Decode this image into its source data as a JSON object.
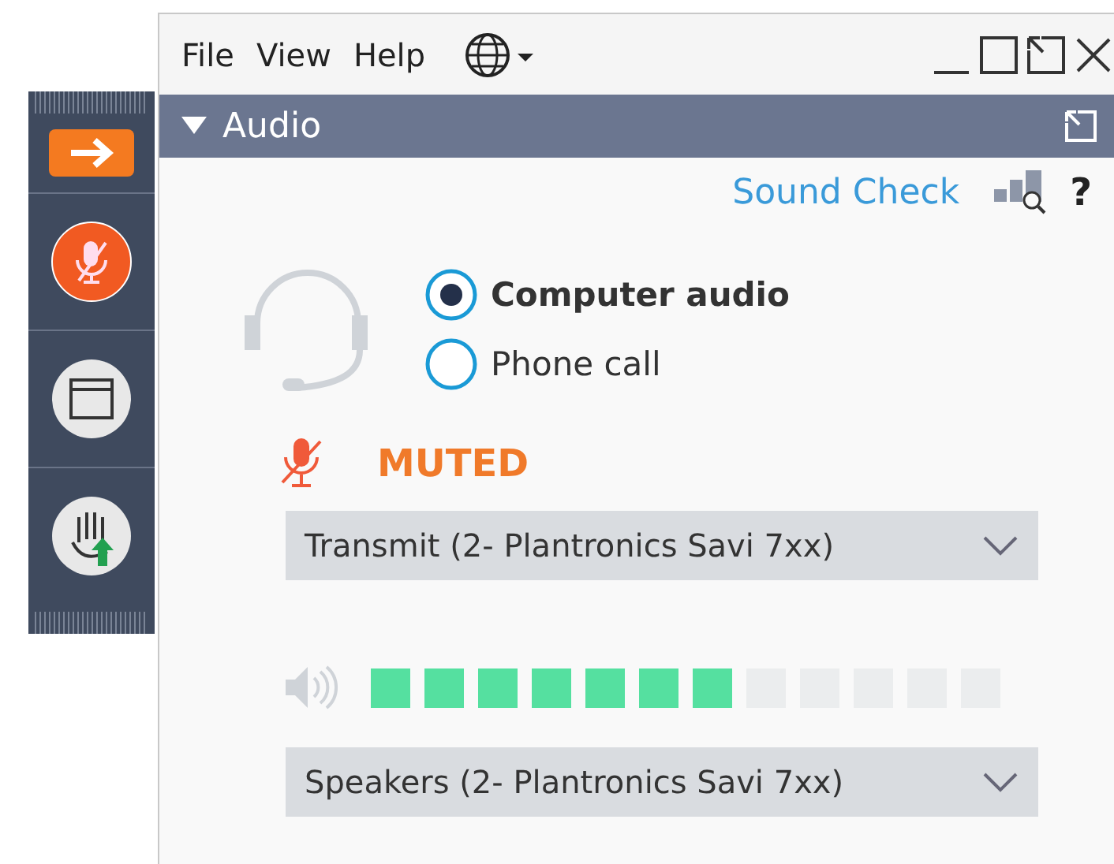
{
  "menu": [
    {
      "label": "File"
    },
    {
      "label": "View"
    },
    {
      "label": "Help"
    }
  ],
  "panel": {
    "title": "Audio",
    "expanded": true
  },
  "sound_check": {
    "label": "Sound Check"
  },
  "help": {
    "label": "?"
  },
  "audio_options": [
    {
      "label": "Computer audio",
      "selected": true
    },
    {
      "label": "Phone call",
      "selected": false
    }
  ],
  "mic_status": {
    "label": "MUTED"
  },
  "transmit": {
    "value": "Transmit (2- Plantronics Savi 7xx)"
  },
  "speaker": {
    "level": 0.5833
  },
  "speakers": {
    "value": "Speakers (2- Plantronics Savi 7xx)"
  }
}
